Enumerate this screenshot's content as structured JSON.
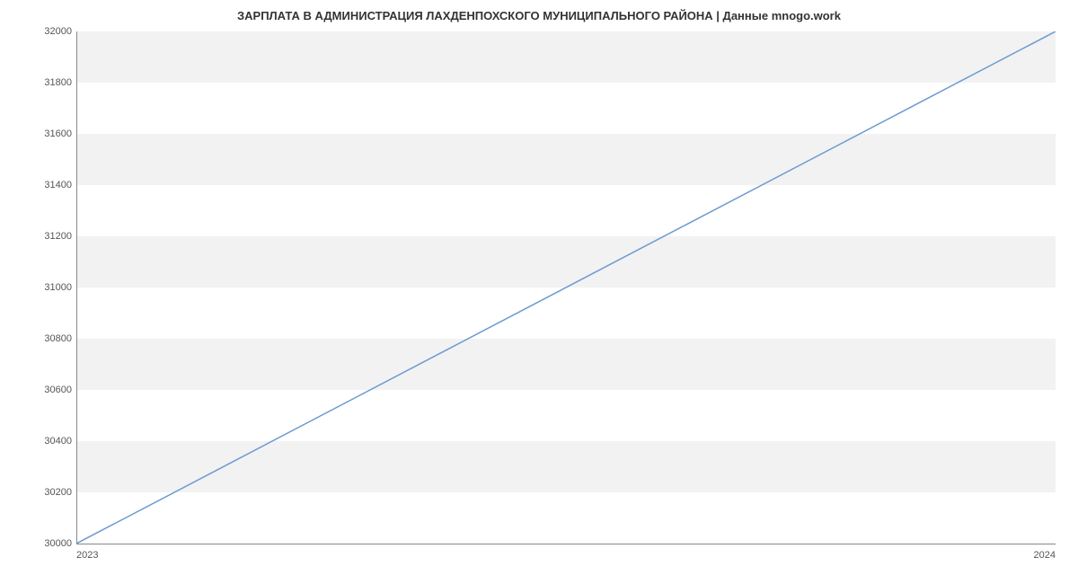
{
  "chart_data": {
    "type": "line",
    "title": "ЗАРПЛАТА В АДМИНИСТРАЦИЯ ЛАХДЕНПОХСКОГО МУНИЦИПАЛЬНОГО РАЙОНА | Данные mnogo.work",
    "x": [
      2023,
      2024
    ],
    "values": [
      30000,
      32000
    ],
    "xlabel": "",
    "ylabel": "",
    "ylim": [
      30000,
      32000
    ],
    "y_ticks": [
      30000,
      30200,
      30400,
      30600,
      30800,
      31000,
      31200,
      31400,
      31600,
      31800,
      32000
    ],
    "x_ticks": [
      2023,
      2024
    ],
    "line_color": "#6b9bd1",
    "band_color": "#f2f2f2"
  }
}
